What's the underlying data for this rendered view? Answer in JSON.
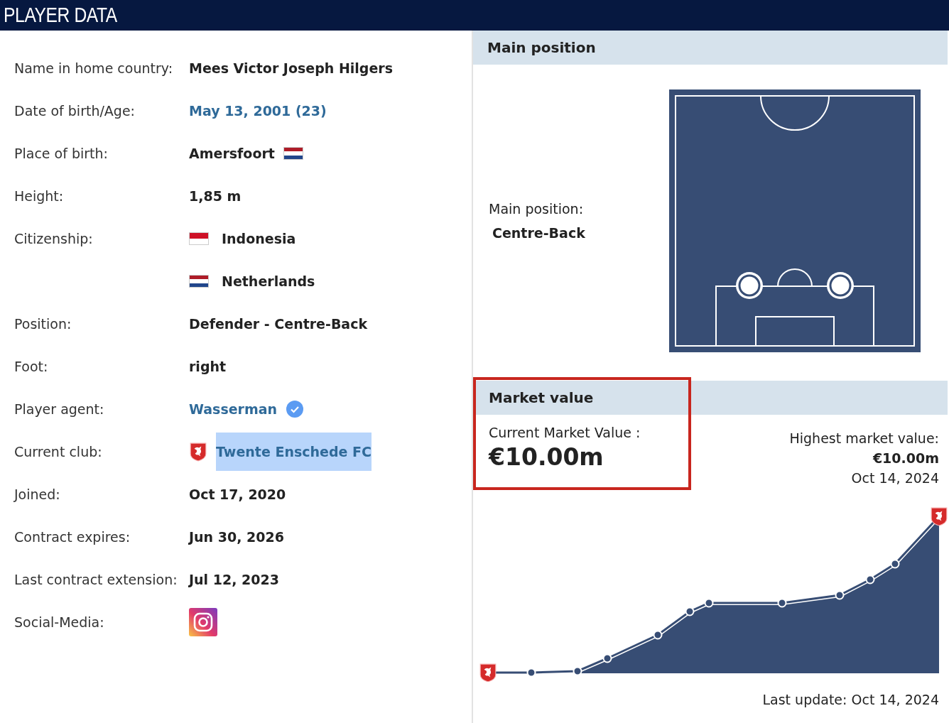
{
  "header": {
    "title": "PLAYER DATA"
  },
  "player_info": [
    {
      "label": "Name in home country:",
      "values": [
        {
          "kind": "text",
          "text": "Mees Victor Joseph Hilgers"
        }
      ]
    },
    {
      "label": "Date of birth/Age:",
      "values": [
        {
          "kind": "link",
          "text": "May 13, 2001 (23)"
        }
      ]
    },
    {
      "label": "Place of birth:",
      "values": [
        {
          "kind": "flag_after",
          "text": "Amersfoort",
          "tricolor_flag": true
        }
      ]
    },
    {
      "label": "Height:",
      "values": [
        {
          "kind": "text",
          "text": "1,85 m"
        }
      ]
    },
    {
      "label": "Citizenship:",
      "values": [
        {
          "kind": "flag_before",
          "text": "Indonesia",
          "tricolor_flag": false
        },
        {
          "kind": "flag_before",
          "text": "Netherlands",
          "tricolor_flag": true
        }
      ]
    },
    {
      "label": "Position:",
      "values": [
        {
          "kind": "text",
          "text": "Defender - Centre-Back"
        }
      ]
    },
    {
      "label": "Foot:",
      "values": [
        {
          "kind": "text",
          "text": "right"
        }
      ]
    },
    {
      "label": "Player agent:",
      "values": [
        {
          "kind": "agent",
          "text": "Wasserman",
          "verified": true
        }
      ]
    },
    {
      "label": "Current club:",
      "values": [
        {
          "kind": "club",
          "text": "Twente Enschede FC",
          "highlighted": true
        }
      ]
    },
    {
      "label": "Joined:",
      "values": [
        {
          "kind": "text",
          "text": "Oct 17, 2020"
        }
      ]
    },
    {
      "label": "Contract expires:",
      "values": [
        {
          "kind": "text",
          "text": "Jun 30, 2026"
        }
      ]
    },
    {
      "label": "Last contract extension:",
      "values": [
        {
          "kind": "text",
          "text": "Jul 12, 2023"
        }
      ]
    },
    {
      "label": "Social-Media:",
      "values": [
        {
          "kind": "instagram"
        }
      ]
    }
  ],
  "main_position": {
    "title": "Main position",
    "label": "Main position:",
    "value": "Centre-Back"
  },
  "market_value": {
    "title": "Market value",
    "framed": true,
    "current_label": "Current Market Value :",
    "current_value": "€10.00m",
    "highest_label": "Highest market value:",
    "highest_value": "€10.00m",
    "highest_date": "Oct 14, 2024",
    "last_update": "Last update: Oct 14, 2024"
  }
}
